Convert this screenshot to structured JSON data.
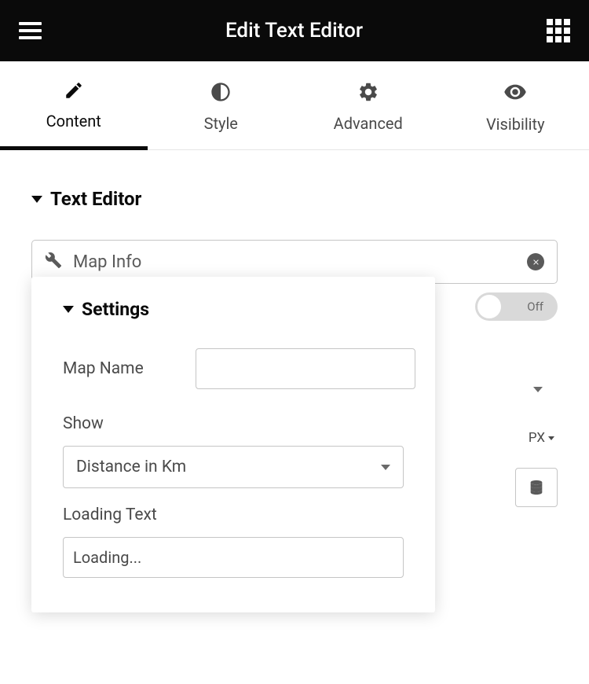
{
  "header": {
    "title": "Edit Text Editor"
  },
  "tabs": [
    {
      "label": "Content",
      "icon": "pencil",
      "active": true
    },
    {
      "label": "Style",
      "icon": "contrast",
      "active": false
    },
    {
      "label": "Advanced",
      "icon": "gear",
      "active": false
    },
    {
      "label": "Visibility",
      "icon": "eye",
      "active": false
    }
  ],
  "section": {
    "title": "Text Editor"
  },
  "dynamicField": {
    "value": "Map Info"
  },
  "popover": {
    "title": "Settings",
    "mapName": {
      "label": "Map Name",
      "value": ""
    },
    "show": {
      "label": "Show",
      "value": "Distance in Km"
    },
    "loadingText": {
      "label": "Loading Text",
      "value": "Loading..."
    }
  },
  "toggle": {
    "state": "Off"
  },
  "unit": {
    "label": "PX"
  }
}
